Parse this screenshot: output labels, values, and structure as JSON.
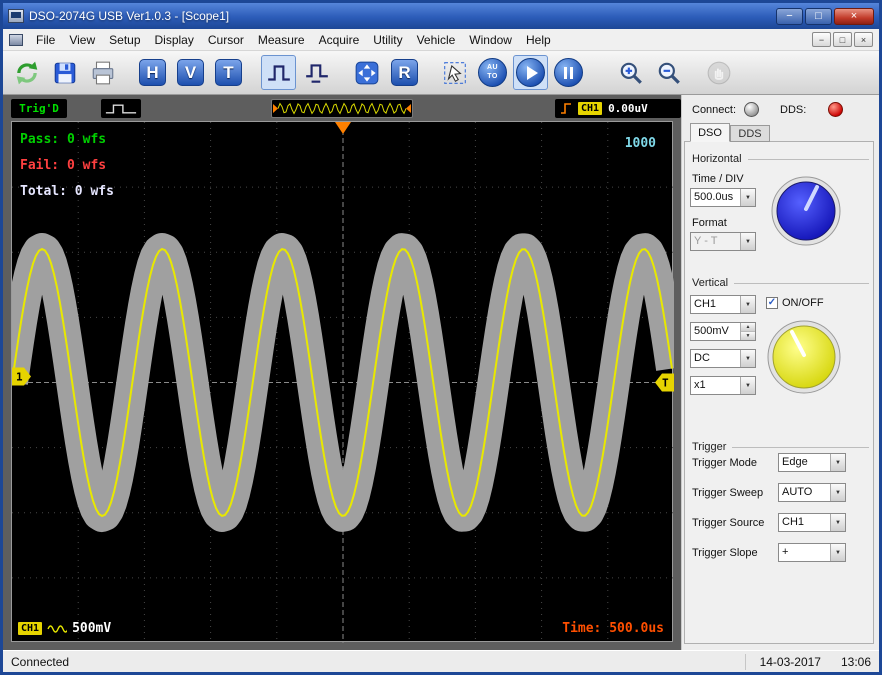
{
  "window": {
    "title": "DSO-2074G USB Ver1.0.3 - [Scope1]",
    "controls": {
      "minimize": "−",
      "maximize": "□",
      "close": "×"
    }
  },
  "menu": {
    "items": [
      "File",
      "View",
      "Setup",
      "Display",
      "Cursor",
      "Measure",
      "Acquire",
      "Utility",
      "Vehicle",
      "Window",
      "Help"
    ],
    "mdi": {
      "minimize": "−",
      "restore": "□",
      "close": "×"
    }
  },
  "toolbar": {
    "h": "H",
    "v": "V",
    "t": "T",
    "r": "R",
    "auto_line1": "AU",
    "auto_line2": "TO",
    "icons": [
      "refresh-icon",
      "save-icon",
      "print-icon",
      "edge-trigger-icon",
      "pulse-trigger-icon",
      "fit-screen-icon",
      "cursor-icon",
      "autoset-icon",
      "play-icon",
      "pause-icon",
      "zoom-in-icon",
      "zoom-out-icon",
      "pan-icon"
    ]
  },
  "scope_header": {
    "trig_status": "Trig'D",
    "channel_badge": "CH1",
    "level_readout": "0.00uV"
  },
  "scope": {
    "pass_label": "Pass: 0 wfs",
    "fail_label": "Fail: 0 wfs",
    "total_label": "Total: 0 wfs",
    "memory_depth": "1000",
    "ch1_badge": "CH1",
    "volt_div": "500mV",
    "time_label": "Time: 500.0us",
    "left_marker": "1",
    "right_marker": "T"
  },
  "waveform": {
    "cycles": 5.5,
    "amplitude_div": 2.05,
    "mask_width": 32,
    "color": "#e8e800",
    "mask_color": "#a0a0a0"
  },
  "preview": {
    "cycles": 14
  },
  "side_panel": {
    "connect_label": "Connect:",
    "dds_label": "DDS:",
    "tabs": [
      "DSO",
      "DDS"
    ],
    "horizontal": {
      "title": "Horizontal",
      "time_div_label": "Time / DIV",
      "time_div_value": "500.0us",
      "format_label": "Format",
      "format_value": "Y - T"
    },
    "vertical": {
      "title": "Vertical",
      "channel_value": "CH1",
      "onoff_label": "ON/OFF",
      "volt_value": "500mV",
      "coupling_value": "DC",
      "probe_value": "x1"
    },
    "trigger": {
      "title": "Trigger",
      "mode_label": "Trigger Mode",
      "mode_value": "Edge",
      "sweep_label": "Trigger Sweep",
      "sweep_value": "AUTO",
      "source_label": "Trigger Source",
      "source_value": "CH1",
      "slope_label": "Trigger Slope",
      "slope_value": "+"
    }
  },
  "statusbar": {
    "left": "Connected",
    "date": "14-03-2017",
    "time": "13:06"
  }
}
